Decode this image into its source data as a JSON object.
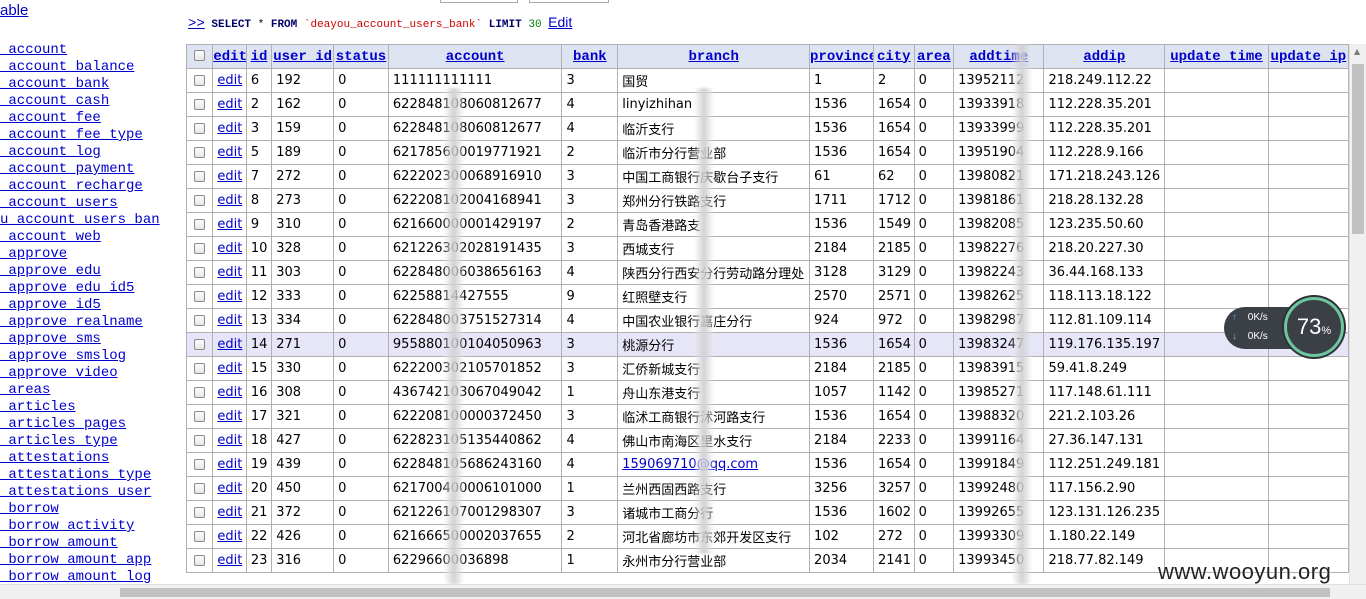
{
  "sidebar": {
    "table_link": "able",
    "items": [
      "_account",
      "_account_balance",
      "_account_bank",
      "_account_cash",
      "_account_fee",
      "_account_fee_type",
      "_account_log",
      "_account_payment",
      "_account_recharge",
      "_account_users",
      "u_account_users_ban",
      "_account_web",
      "_approve",
      "_approve_edu",
      "_approve_edu_id5",
      "_approve_id5",
      "_approve_realname",
      "_approve_sms",
      "_approve_smslog",
      "_approve_video",
      "_areas",
      "_articles",
      "_articles_pages",
      "_articles_type",
      "_attestations",
      "_attestations_type",
      "_attestations_user",
      "_borrow",
      "_borrow_activity",
      "_borrow_amount",
      "_borrow_amount_app",
      "_borrow_amount_log"
    ]
  },
  "query": {
    "arrows": ">>",
    "select": "SELECT",
    "star": "*",
    "from": "FROM",
    "table": "`deayou_account_users_bank`",
    "limit": "LIMIT",
    "limit_value": "30",
    "edit_label": "Edit"
  },
  "table": {
    "edit_header": "edit",
    "columns": [
      "id",
      "user_id",
      "status",
      "account",
      "bank",
      "branch",
      "province",
      "city",
      "area",
      "addtime",
      "addip",
      "update_time",
      "update_ip"
    ],
    "edit_label": "edit",
    "rows": [
      [
        "6",
        "192",
        "0",
        "111111111111",
        "3",
        "国贸",
        "1",
        "2",
        "0",
        "13952112",
        "218.249.112.22",
        "",
        ""
      ],
      [
        "2",
        "162",
        "0",
        "622848108060812677",
        "4",
        "linyizhihan",
        "1536",
        "1654",
        "0",
        "13933918",
        "112.228.35.201",
        "",
        ""
      ],
      [
        "3",
        "159",
        "0",
        "622848108060812677",
        "4",
        "临沂支行",
        "1536",
        "1654",
        "0",
        "13933999",
        "112.228.35.201",
        "",
        ""
      ],
      [
        "5",
        "189",
        "0",
        "621785600019771921",
        "2",
        "临沂市分行营业部",
        "1536",
        "1654",
        "0",
        "13951904",
        "112.228.9.166",
        "",
        ""
      ],
      [
        "7",
        "272",
        "0",
        "622202300068916910",
        "3",
        "中国工商银行庆歇台子支行",
        "61",
        "62",
        "0",
        "13980821",
        "171.218.243.126",
        "",
        ""
      ],
      [
        "8",
        "273",
        "0",
        "622208102004168941",
        "3",
        "郑州分行铁路支行",
        "1711",
        "1712",
        "0",
        "13981861",
        "218.28.132.28",
        "",
        ""
      ],
      [
        "9",
        "310",
        "0",
        "621660000001429197",
        "2",
        "青岛香港路支",
        "1536",
        "1549",
        "0",
        "13982085",
        "123.235.50.60",
        "",
        ""
      ],
      [
        "10",
        "328",
        "0",
        "621226302028191435",
        "3",
        "西城支行",
        "2184",
        "2185",
        "0",
        "13982276",
        "218.20.227.30",
        "",
        ""
      ],
      [
        "11",
        "303",
        "0",
        "622848006038656163",
        "4",
        "陕西分行西安分行劳动路分理处",
        "3128",
        "3129",
        "0",
        "13982243",
        "36.44.168.133",
        "",
        ""
      ],
      [
        "12",
        "333",
        "0",
        "62258814427555",
        "9",
        "红照壁支行",
        "2570",
        "2571",
        "0",
        "13982625",
        "118.113.18.122",
        "",
        ""
      ],
      [
        "13",
        "334",
        "0",
        "622848003751527314",
        "4",
        "中国农业银行嘉庄分行",
        "924",
        "972",
        "0",
        "13982987",
        "112.81.109.114",
        "",
        ""
      ],
      [
        "14",
        "271",
        "0",
        "955880100104050963",
        "3",
        "桃源分行",
        "1536",
        "1654",
        "0",
        "13983247",
        "119.176.135.197",
        "",
        ""
      ],
      [
        "15",
        "330",
        "0",
        "622200302105701852",
        "3",
        "汇侨新城支行",
        "2184",
        "2185",
        "0",
        "13983915",
        "59.41.8.249",
        "",
        ""
      ],
      [
        "16",
        "308",
        "0",
        "436742103067049042",
        "1",
        "舟山东港支行",
        "1057",
        "1142",
        "0",
        "13985271",
        "117.148.61.111",
        "",
        ""
      ],
      [
        "17",
        "321",
        "0",
        "622208100000372450",
        "3",
        "临沭工商银行沭河路支行",
        "1536",
        "1654",
        "0",
        "13988320",
        "221.2.103.26",
        "",
        ""
      ],
      [
        "18",
        "427",
        "0",
        "622823105135440862",
        "4",
        "佛山市南海区里水支行",
        "2184",
        "2233",
        "0",
        "13991164",
        "27.36.147.131",
        "",
        ""
      ],
      [
        "19",
        "439",
        "0",
        "622848105686243160",
        "4",
        "159069710@qq.com",
        "1536",
        "1654",
        "0",
        "13991849",
        "112.251.249.181",
        "",
        ""
      ],
      [
        "20",
        "450",
        "0",
        "621700400006101000",
        "1",
        "兰州西固西路支行",
        "3256",
        "3257",
        "0",
        "13992480",
        "117.156.2.90",
        "",
        ""
      ],
      [
        "21",
        "372",
        "0",
        "621226107001298307",
        "3",
        "诸城市工商分行",
        "1536",
        "1602",
        "0",
        "13992655",
        "123.131.126.235",
        "",
        ""
      ],
      [
        "22",
        "426",
        "0",
        "621666500002037655",
        "2",
        "河北省廊坊市东郊开发区支行",
        "102",
        "272",
        "0",
        "13993309",
        "1.180.22.149",
        "",
        ""
      ],
      [
        "23",
        "316",
        "0",
        "62296600036898",
        "1",
        "永州市分行营业部",
        "2034",
        "2141",
        "0",
        "13993450",
        "218.77.82.149",
        "",
        ""
      ]
    ],
    "highlight_row_index": 11,
    "link_cell": {
      "row": 16,
      "col": 5
    }
  },
  "network": {
    "up_speed": "0K/s",
    "down_speed": "0K/s",
    "cpu_percent": "73",
    "percent_sign": "%"
  },
  "watermark": "www.wooyun.org"
}
